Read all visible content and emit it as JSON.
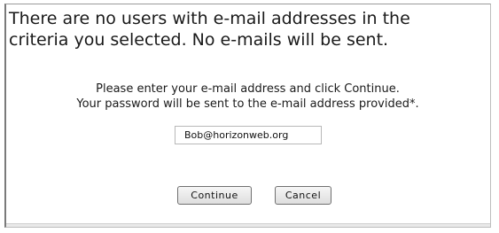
{
  "message": {
    "line1": "There are no users with e-mail addresses in the",
    "line2": "criteria you selected. No e-mails will be sent."
  },
  "instructions": {
    "line1": "Please enter your e-mail address and click Continue.",
    "line2": "Your password will be sent to the e-mail address provided*."
  },
  "form": {
    "email_value": "Bob@horizonweb.org",
    "continue_label": "Continue",
    "cancel_label": "Cancel"
  }
}
